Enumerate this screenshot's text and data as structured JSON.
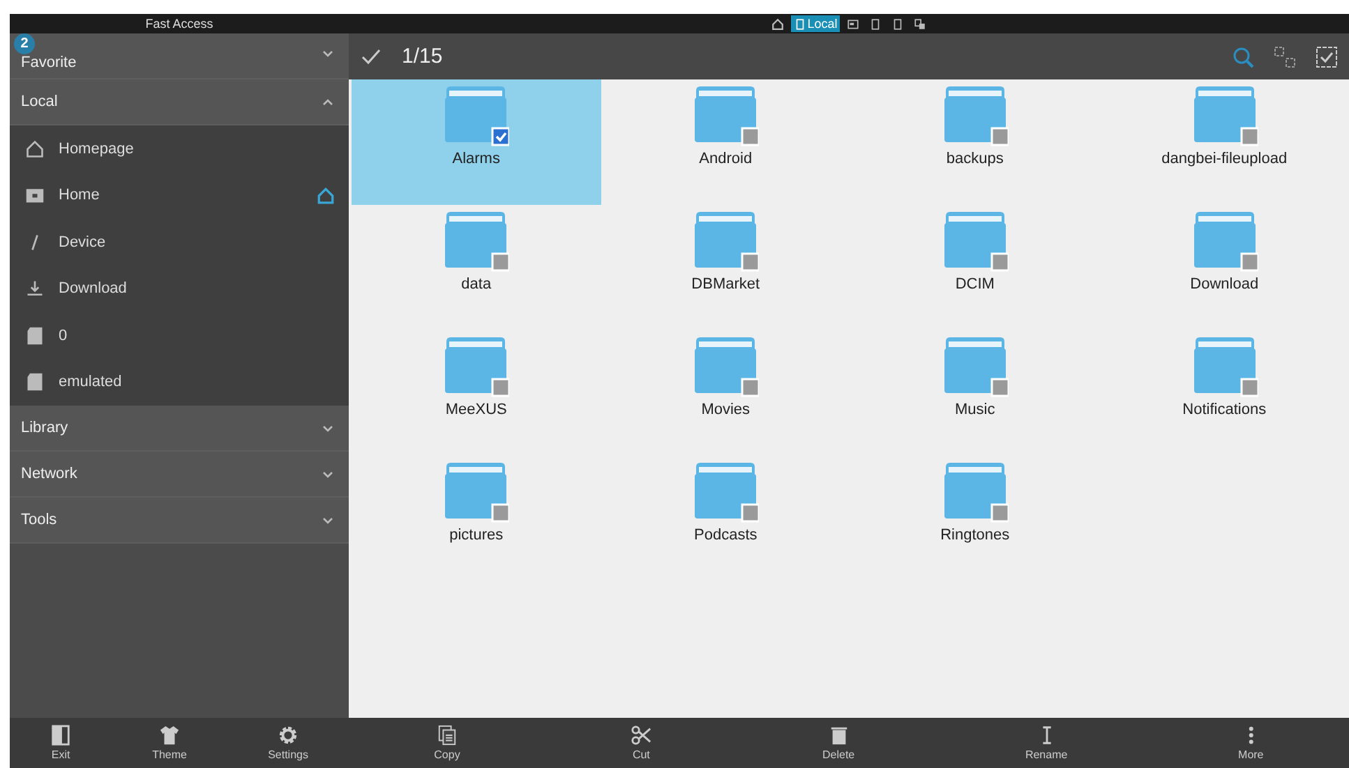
{
  "sidebar": {
    "title": "Fast Access",
    "badge": "2",
    "sections": [
      {
        "label": "Favorite",
        "expanded": false
      },
      {
        "label": "Local",
        "expanded": true,
        "items": [
          {
            "kind": "homepage",
            "label": "Homepage",
            "is_home": false
          },
          {
            "kind": "folder",
            "label": "Home",
            "is_home": true
          },
          {
            "kind": "slash",
            "label": "Device",
            "is_home": false
          },
          {
            "kind": "download",
            "label": "Download",
            "is_home": false
          },
          {
            "kind": "sd",
            "label": "0",
            "is_home": false
          },
          {
            "kind": "sd",
            "label": "emulated",
            "is_home": false
          }
        ]
      },
      {
        "label": "Library",
        "expanded": false
      },
      {
        "label": "Network",
        "expanded": false
      },
      {
        "label": "Tools",
        "expanded": false
      }
    ],
    "actions": [
      {
        "kind": "exit",
        "label": "Exit"
      },
      {
        "kind": "theme",
        "label": "Theme"
      },
      {
        "kind": "settings",
        "label": "Settings"
      }
    ]
  },
  "tabs": [
    {
      "kind": "home",
      "selected": false
    },
    {
      "kind": "phone",
      "label": "Local",
      "selected": true
    },
    {
      "kind": "window",
      "selected": false
    },
    {
      "kind": "phone",
      "selected": false
    },
    {
      "kind": "phone",
      "selected": false
    },
    {
      "kind": "multi",
      "selected": false
    }
  ],
  "toolbar": {
    "count": "1/15"
  },
  "files": [
    {
      "name": "Alarms",
      "selected": true
    },
    {
      "name": "Android",
      "selected": false
    },
    {
      "name": "backups",
      "selected": false
    },
    {
      "name": "dangbei-fileupload",
      "selected": false
    },
    {
      "name": "data",
      "selected": false
    },
    {
      "name": "DBMarket",
      "selected": false
    },
    {
      "name": "DCIM",
      "selected": false
    },
    {
      "name": "Download",
      "selected": false
    },
    {
      "name": "MeeXUS",
      "selected": false
    },
    {
      "name": "Movies",
      "selected": false
    },
    {
      "name": "Music",
      "selected": false
    },
    {
      "name": "Notifications",
      "selected": false
    },
    {
      "name": "pictures",
      "selected": false
    },
    {
      "name": "Podcasts",
      "selected": false
    },
    {
      "name": "Ringtones",
      "selected": false
    }
  ],
  "actions": [
    {
      "kind": "copy",
      "label": "Copy"
    },
    {
      "kind": "cut",
      "label": "Cut"
    },
    {
      "kind": "delete",
      "label": "Delete"
    },
    {
      "kind": "rename",
      "label": "Rename"
    },
    {
      "kind": "more",
      "label": "More"
    }
  ]
}
